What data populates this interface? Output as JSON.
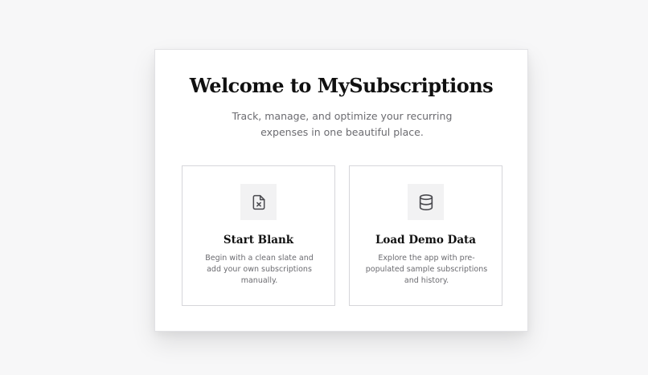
{
  "welcome": {
    "title": "Welcome to MySubscriptions",
    "subtitle": "Track, manage, and optimize your recurring expenses in one beautiful place."
  },
  "options": [
    {
      "icon": "file-x-icon",
      "title": "Start Blank",
      "description": "Begin with a clean slate and add your own subscriptions manually."
    },
    {
      "icon": "database-icon",
      "title": "Load Demo Data",
      "description": "Explore the app with pre-populated sample subscriptions and history."
    }
  ],
  "colors": {
    "background": "#f7f7f8",
    "card": "#ffffff",
    "card_border": "#d6d6da",
    "icon_box": "#f2f2f3",
    "title_text": "#101010",
    "muted_text": "#6b6b70"
  }
}
